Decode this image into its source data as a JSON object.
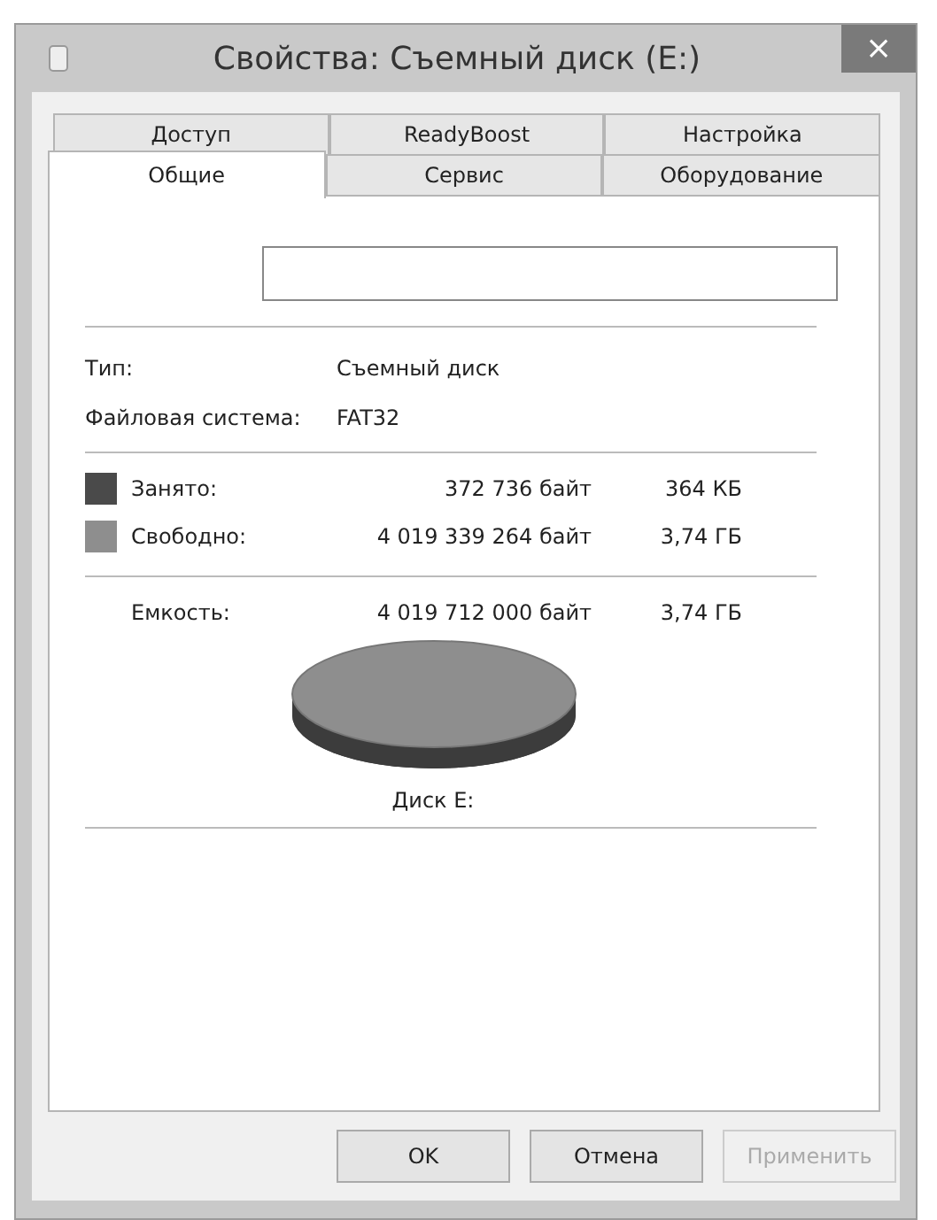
{
  "window": {
    "title": "Свойства: Съемный диск (E:)",
    "close": "×"
  },
  "tabs": [
    [
      {
        "label": "Доступ",
        "selected": false
      },
      {
        "label": "ReadyBoost",
        "selected": false
      },
      {
        "label": "Настройка",
        "selected": false
      }
    ],
    [
      {
        "label": "Общие",
        "selected": true
      },
      {
        "label": "Сервис",
        "selected": false
      },
      {
        "label": "Оборудование",
        "selected": false
      }
    ]
  ],
  "info": [
    {
      "label": "Тип:",
      "value": "Съемный диск"
    },
    {
      "label": "Файловая система:",
      "value": "FAT32"
    }
  ],
  "usage": [
    {
      "label": "Занято:",
      "bytes": "372 736 байт",
      "size": "364 КБ",
      "color": "#4a4a4a"
    },
    {
      "label": "Свободно:",
      "bytes": "4 019 339 264 байт",
      "size": "3,74 ГБ",
      "color": "#8e8e8e"
    }
  ],
  "capacity": {
    "label": "Емкость:",
    "bytes": "4 019 712 000 байт",
    "size": "3,74 ГБ"
  },
  "disk_label": "Диск E:",
  "buttons": [
    {
      "label": "OK",
      "disabled": false
    },
    {
      "label": "Отмена",
      "disabled": false
    },
    {
      "label": "Применить",
      "disabled": true
    }
  ]
}
